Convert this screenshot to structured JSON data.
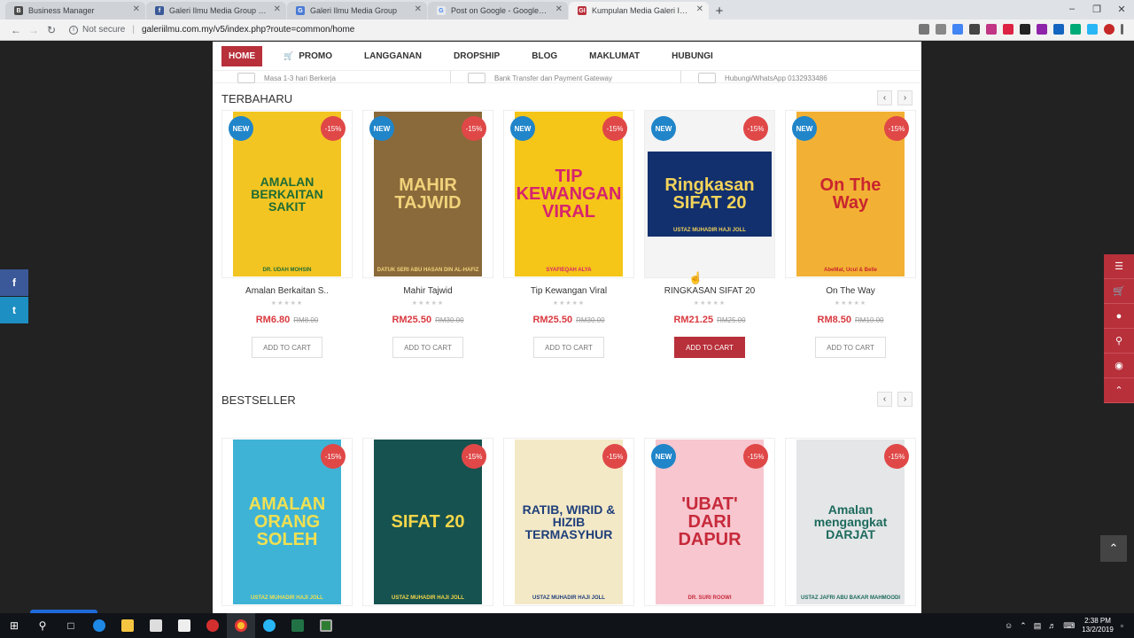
{
  "browser": {
    "tabs": [
      {
        "title": "Business Manager",
        "color": "#4a4a4a",
        "glyph": "B",
        "active": false
      },
      {
        "title": "Galeri Ilmu Media Group - Home",
        "color": "#3b5998",
        "glyph": "f",
        "active": false
      },
      {
        "title": "Galeri Ilmu Media Group",
        "color": "#4a7bd4",
        "glyph": "G",
        "active": false
      },
      {
        "title": "Post on Google - Google My Bus",
        "color": "#e8eaed",
        "glyph": "G",
        "active": false
      },
      {
        "title": "Kumpulan Media Galeri Ilmu",
        "color": "#b8303a",
        "glyph": "GI",
        "active": true
      }
    ],
    "new_tab": "+",
    "security": "Not secure",
    "url": "galeriilmu.com.my/v5/index.php?route=common/home"
  },
  "nav": {
    "home": "HOME",
    "promo": "PROMO",
    "langganan": "LANGGANAN",
    "dropship": "DROPSHIP",
    "blog": "BLOG",
    "maklumat": "MAKLUMAT",
    "hubungi": "HUBUNGI"
  },
  "info_strip": {
    "delivery": "Masa 1-3 hari Berkerja",
    "payment": "Bank Transfer dan Payment Gateway",
    "contact": "Hubungi/WhatsApp 0132933486"
  },
  "labels": {
    "new": "NEW",
    "off": "-15%",
    "add_to_cart": "ADD TO CART",
    "stars": "★★★★★"
  },
  "terbaharu": {
    "title": "TERBAHARU",
    "products": [
      {
        "name": "Amalan Berkaitan S..",
        "price": "RM6.80",
        "old_price": "RM8.00",
        "is_new": true,
        "cover_title": "AMALAN BERKAITAN SAKIT",
        "cover_author": "DR. UDAH MOHSIN",
        "cover_bg": "#f3c522",
        "cover_fg": "#1e6b35"
      },
      {
        "name": "Mahir Tajwid",
        "price": "RM25.50",
        "old_price": "RM30.00",
        "is_new": true,
        "cover_title": "MAHIR TAJWID",
        "cover_author": "DATUK SERI ABU HASAN DIN AL-HAFIZ",
        "cover_bg": "#8a6a3a",
        "cover_fg": "#f1d27a"
      },
      {
        "name": "Tip Kewangan Viral",
        "price": "RM25.50",
        "old_price": "RM30.00",
        "is_new": true,
        "cover_title": "TIP KEWANGAN VIRAL",
        "cover_author": "SYAFIEQAH ALYA",
        "cover_bg": "#f5c518",
        "cover_fg": "#d6246e"
      },
      {
        "name": "RINGKASAN SIFAT 20",
        "price": "RM21.25",
        "old_price": "RM25.00",
        "is_new": true,
        "cover_title": "Ringkasan SIFAT 20",
        "cover_author": "USTAZ MUHADIR HAJI JOLL",
        "cover_bg": "#12306e",
        "cover_fg": "#f3d35a"
      },
      {
        "name": "On The Way",
        "price": "RM8.50",
        "old_price": "RM10.00",
        "is_new": true,
        "cover_title": "On The Way",
        "cover_author": "AbeMat, Ucul & Belle",
        "cover_bg": "#f2b134",
        "cover_fg": "#c9252f"
      }
    ]
  },
  "bestseller": {
    "title": "BESTSELLER",
    "products": [
      {
        "is_new": false,
        "cover_title": "AMALAN ORANG SOLEH",
        "cover_author": "USTAZ MUHADIR HAJI JOLL",
        "cover_bg": "#3fb3d6",
        "cover_fg": "#f0e052"
      },
      {
        "is_new": false,
        "cover_title": "SIFAT 20",
        "cover_author": "USTAZ MUHADIR HAJI JOLL",
        "cover_bg": "#16524f",
        "cover_fg": "#f4d64a"
      },
      {
        "is_new": false,
        "cover_title": "RATIB, WIRID & HIZIB TERMASYHUR",
        "cover_author": "USTAZ MUHADIR HAJI JOLL",
        "cover_bg": "#f4e9c7",
        "cover_fg": "#1f3f7a"
      },
      {
        "is_new": true,
        "cover_title": "'UBAT' DARI DAPUR",
        "cover_author": "DR. SURI ROOWI",
        "cover_bg": "#f7c6cf",
        "cover_fg": "#c72a3b"
      },
      {
        "is_new": false,
        "cover_title": "Amalan mengangkat DARJAT",
        "cover_author": "USTAZ JAFRI ABU BAKAR MAHMOODI",
        "cover_bg": "#e4e6e8",
        "cover_fg": "#1d6a5c"
      }
    ]
  },
  "social": {
    "facebook": "f",
    "twitter": "t"
  },
  "taskbar": {
    "time": "2:38 PM",
    "date": "13/2/2019"
  }
}
